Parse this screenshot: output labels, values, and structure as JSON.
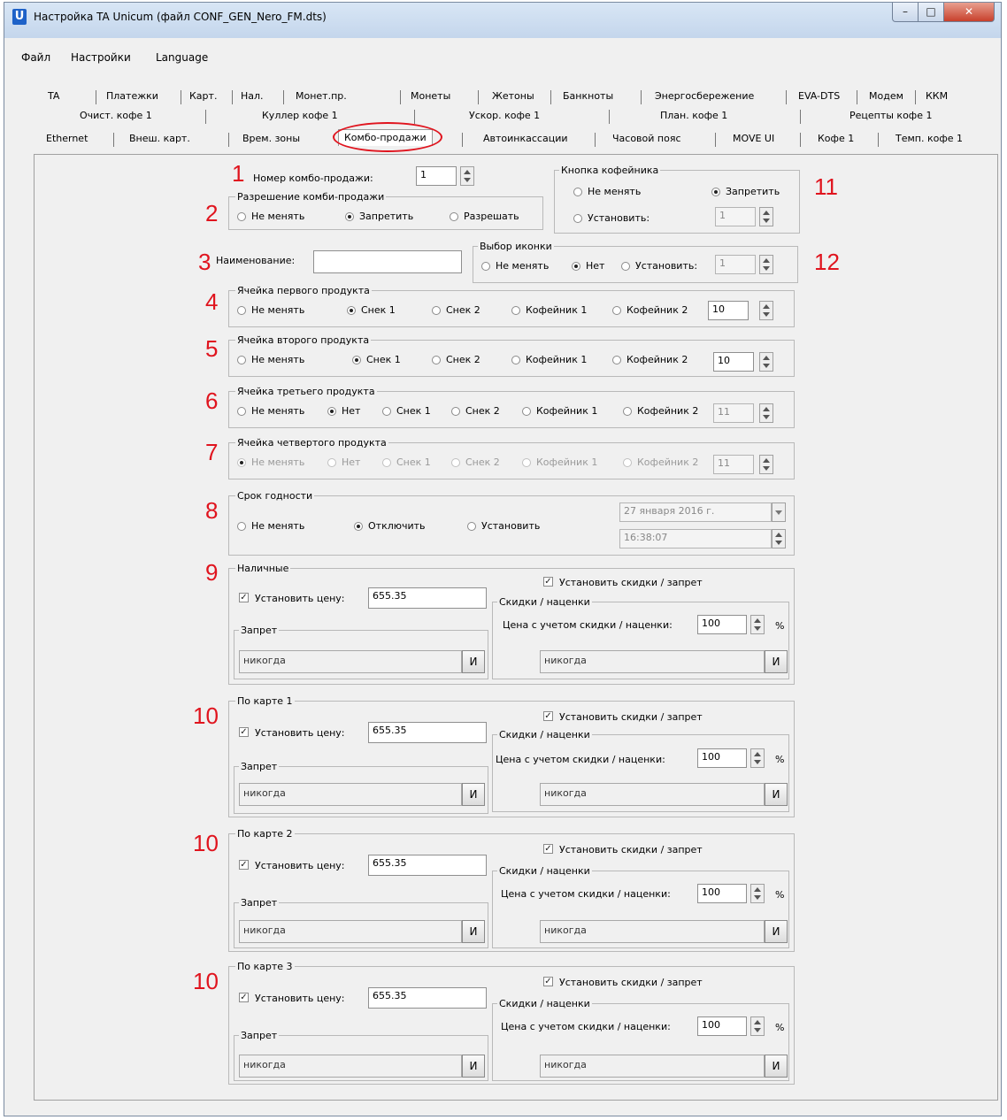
{
  "window": {
    "title": "Настройка TA Unicum (файл CONF_GEN_Nero_FM.dts)",
    "app_icon": "U"
  },
  "menu": [
    "Файл",
    "Настройки",
    "Language"
  ],
  "tabs_row1": [
    "TA",
    "Платежки",
    "Карт.",
    "Нал.",
    "Монет.пр.",
    "Монеты",
    "Жетоны",
    "Банкноты",
    "Энергосбережение",
    "EVA-DTS",
    "Модем",
    "ККМ"
  ],
  "tabs_row2": [
    "Очист. кофе 1",
    "Куллер кофе 1",
    "Ускор. кофе 1",
    "План. кофе 1",
    "Рецепты кофе 1"
  ],
  "tabs_row3": [
    "Ethernet",
    "Внеш. карт.",
    "Врем. зоны",
    "Комбо-продажи",
    "Автоинкассации",
    "Часовой пояс",
    "MOVE UI",
    "Кофе 1",
    "Темп. кофе 1"
  ],
  "markers": [
    "1",
    "2",
    "3",
    "4",
    "5",
    "6",
    "7",
    "8",
    "9",
    "10",
    "10",
    "10",
    "11",
    "12"
  ],
  "combo": {
    "label": "Номер комбо-продажи:",
    "value": "1"
  },
  "permission": {
    "title": "Разрешение комби-продажи",
    "opt1": "Не менять",
    "opt2": "Запретить",
    "opt3": "Разрешать"
  },
  "coffee_btn": {
    "title": "Кнопка кофейника",
    "opt1": "Не менять",
    "opt2": "Запретить",
    "opt3": "Установить:",
    "value": "1"
  },
  "name": {
    "label": "Наименование:",
    "value": ""
  },
  "icon_choice": {
    "title": "Выбор иконки",
    "opt1": "Не менять",
    "opt2": "Нет",
    "opt3": "Установить:",
    "value": "1"
  },
  "cell1": {
    "title": "Ячейка первого продукта",
    "opts": [
      "Не менять",
      "Снек 1",
      "Снек 2",
      "Кофейник 1",
      "Кофейник 2"
    ],
    "value": "10"
  },
  "cell2": {
    "title": "Ячейка второго продукта",
    "opts": [
      "Не менять",
      "Снек 1",
      "Снек 2",
      "Кофейник 1",
      "Кофейник 2"
    ],
    "value": "10"
  },
  "cell3": {
    "title": "Ячейка третьего продукта",
    "opts": [
      "Не менять",
      "Нет",
      "Снек 1",
      "Снек 2",
      "Кофейник 1",
      "Кофейник 2"
    ],
    "value": "11"
  },
  "cell4": {
    "title": "Ячейка четвертого продукта",
    "opts": [
      "Не менять",
      "Нет",
      "Снек 1",
      "Снек 2",
      "Кофейник 1",
      "Кофейник 2"
    ],
    "value": "11"
  },
  "expiry": {
    "title": "Срок годности",
    "opt1": "Не менять",
    "opt2": "Отключить",
    "opt3": "Установить",
    "date": "27 января 2016 г.",
    "time": "16:38:07"
  },
  "cash": {
    "title": "Наличные",
    "set_price": "Установить цену:",
    "price": "655.35",
    "set_disc": "Установить скидки / запрет",
    "disc_title": "Скидки / наценки",
    "disc_label": "Цена с учетом скидки / наценки:",
    "disc_value": "100",
    "pct": "%",
    "ban_title": "Запрет",
    "ban_value": "никогда",
    "disc_field": "никогда",
    "btn": "И"
  },
  "card1": {
    "title": "По карте 1",
    "set_price": "Установить цену:",
    "price": "655.35",
    "set_disc": "Установить скидки / запрет",
    "disc_title": "Скидки / наценки",
    "disc_label": "Цена с учетом скидки / наценки:",
    "disc_value": "100",
    "pct": "%",
    "ban_title": "Запрет",
    "ban_value": "никогда",
    "disc_field": "никогда",
    "btn": "И"
  },
  "card2": {
    "title": "По карте 2",
    "set_price": "Установить цену:",
    "price": "655.35",
    "set_disc": "Установить скидки / запрет",
    "disc_title": "Скидки / наценки",
    "disc_label": "Цена с учетом скидки / наценки:",
    "disc_value": "100",
    "pct": "%",
    "ban_title": "Запрет",
    "ban_value": "никогда",
    "disc_field": "никогда",
    "btn": "И"
  },
  "card3": {
    "title": "По карте 3",
    "set_price": "Установить цену:",
    "price": "655.35",
    "set_disc": "Установить скидки / запрет",
    "disc_title": "Скидки / наценки",
    "disc_label": "Цена с учетом скидки / наценки:",
    "disc_value": "100",
    "pct": "%",
    "ban_title": "Запрет",
    "ban_value": "никогда",
    "disc_field": "никогда",
    "btn": "И"
  }
}
